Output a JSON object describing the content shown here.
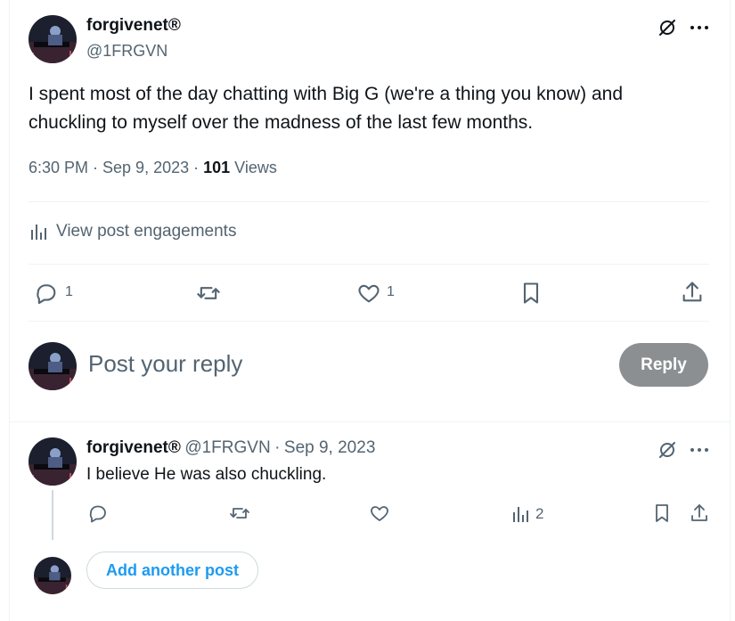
{
  "post": {
    "author_name": "forgivenet®",
    "author_handle": "@1FRGVN",
    "text": "I spent most of the day chatting with Big G (we're a thing you know) and chuckling to myself over the madness of the last few months.",
    "meta_time": "6:30 PM · Sep 9, 2023 · ",
    "views_count": "101",
    "views_label": " Views",
    "engagements_label": "View post engagements",
    "actions": {
      "reply_count": "1",
      "repost_count": "",
      "like_count": "1"
    }
  },
  "composer": {
    "placeholder": "Post your reply",
    "reply_button": "Reply"
  },
  "thread_reply": {
    "author_name": "forgivenet®",
    "author_handle": "@1FRGVN",
    "separator": "·",
    "date": "Sep 9, 2023",
    "text": "I believe He was also chuckling.",
    "views_count": "2"
  },
  "add_post": {
    "label": "Add another post"
  },
  "icons": {
    "grok": "grok-slash-icon",
    "more": "more-dots-icon",
    "stats": "bar-chart-icon",
    "reply": "comment-bubble-icon",
    "repost": "repost-arrows-icon",
    "like": "heart-icon",
    "bookmark": "bookmark-icon",
    "share": "share-upload-icon"
  },
  "colors": {
    "text": "#0f1419",
    "secondary": "#536471",
    "accent": "#1d9bf0",
    "reply_button_disabled": "#8b8f92",
    "divider": "#eff3f4"
  }
}
